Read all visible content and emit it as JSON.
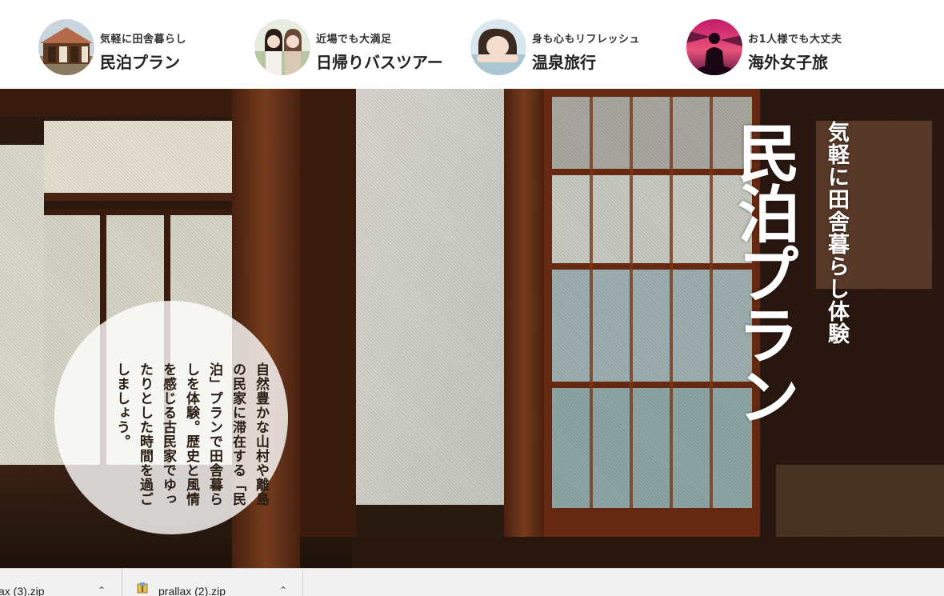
{
  "nav": [
    {
      "subtitle": "気軽に田舎暮らし",
      "title": "民泊プラン",
      "thumb": "thatched-house-photo"
    },
    {
      "subtitle": "近場でも大満足",
      "title": "日帰りバスツアー",
      "thumb": "two-girls-photo"
    },
    {
      "subtitle": "身も心もリフレッシュ",
      "title": "温泉旅行",
      "thumb": "woman-bath-photo"
    },
    {
      "subtitle": "お1人様でも大丈夫",
      "title": "海外女子旅",
      "thumb": "silhouette-sunset-photo"
    }
  ],
  "hero": {
    "title": "民泊プラン",
    "subtitle": "気軽に田舎暮らし体験",
    "description": "自然豊かな山村や離島の民家に滞在する「民泊」プランで田舎暮らしを体験。歴史と風情を感じる古民家でゆったりとした時間を過ごしましょう。"
  },
  "downloads": [
    {
      "name": "ax (3).zip",
      "icon": "zip-file-icon"
    },
    {
      "name": "prallax (2).zip",
      "icon": "zip-file-icon"
    }
  ],
  "colors": {
    "wood": "#5a2c16",
    "shoji": "#e8e4d4",
    "glass": "#8fa8a8"
  }
}
